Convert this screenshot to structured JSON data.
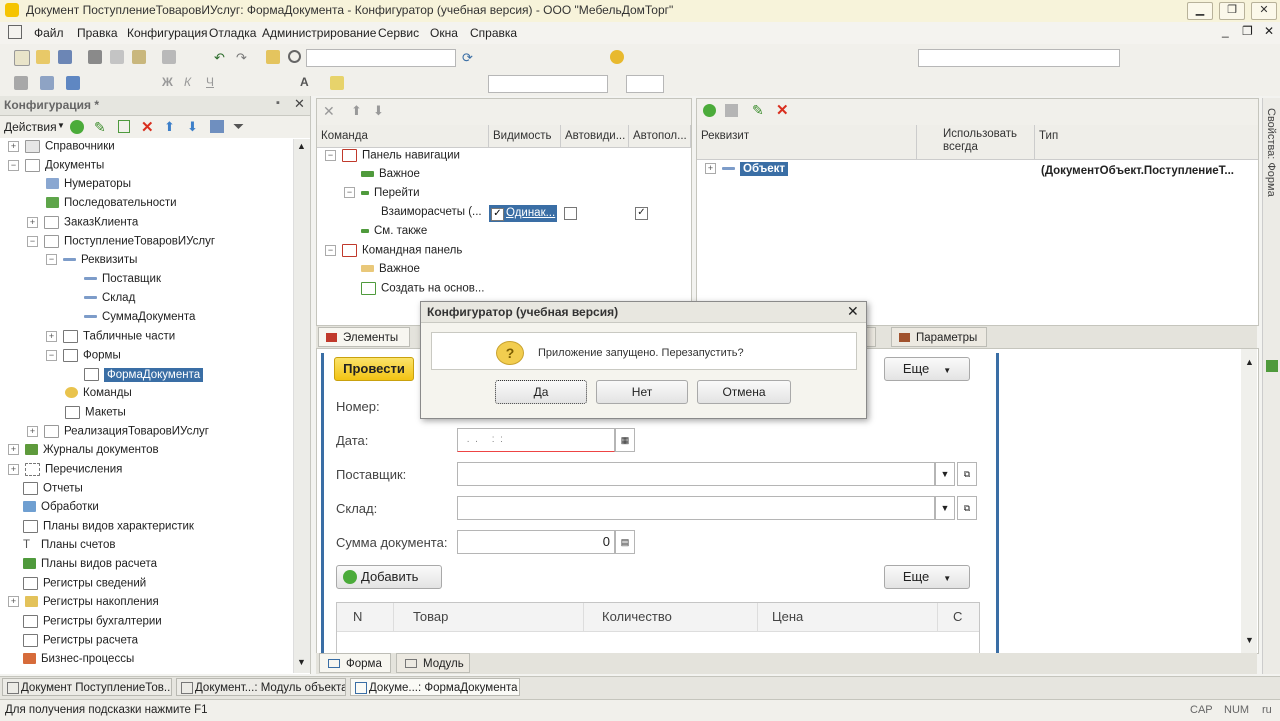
{
  "window": {
    "title": "Документ ПоступлениеТоваровИУслуг: ФормаДокумента - Конфигуратор (учебная версия) - ООО \"МебельДомТорг\""
  },
  "menu": [
    "Файл",
    "Правка",
    "Конфигурация",
    "Отладка",
    "Администрирование",
    "Сервис",
    "Окна",
    "Справка"
  ],
  "config_panel": {
    "title": "Конфигурация *",
    "actions_label": "Действия",
    "tree": [
      {
        "label": "Справочники"
      },
      {
        "label": "Документы"
      },
      {
        "label": "Нумераторы"
      },
      {
        "label": "Последовательности"
      },
      {
        "label": "ЗаказКлиента"
      },
      {
        "label": "ПоступлениеТоваровИУслуг"
      },
      {
        "label": "Реквизиты"
      },
      {
        "label": "Поставщик"
      },
      {
        "label": "Склад"
      },
      {
        "label": "СуммаДокумента"
      },
      {
        "label": "Табличные части"
      },
      {
        "label": "Формы"
      },
      {
        "label": "ФормаДокумента"
      },
      {
        "label": "Команды"
      },
      {
        "label": "Макеты"
      },
      {
        "label": "РеализацияТоваровИУслуг"
      },
      {
        "label": "Журналы документов"
      },
      {
        "label": "Перечисления"
      },
      {
        "label": "Отчеты"
      },
      {
        "label": "Обработки"
      },
      {
        "label": "Планы видов характеристик"
      },
      {
        "label": "Планы счетов"
      },
      {
        "label": "Планы видов расчета"
      },
      {
        "label": "Регистры сведений"
      },
      {
        "label": "Регистры накопления"
      },
      {
        "label": "Регистры бухгалтерии"
      },
      {
        "label": "Регистры расчета"
      },
      {
        "label": "Бизнес-процессы"
      }
    ]
  },
  "commands_panel": {
    "headers": [
      "Команда",
      "Видимость",
      "Автовиди...",
      "Автопол..."
    ],
    "rows": [
      {
        "label": "Панель навигации"
      },
      {
        "label": "Важное"
      },
      {
        "label": "Перейти"
      },
      {
        "label": "Взаиморасчеты (...",
        "visibility": "Одинак..."
      },
      {
        "label": "См. также"
      },
      {
        "label": "Командная панель"
      },
      {
        "label": "Важное"
      },
      {
        "label": "Создать на основ..."
      }
    ]
  },
  "attributes_panel": {
    "headers": [
      "Реквизит",
      "Использовать всегда",
      "Тип"
    ],
    "row": {
      "name": "Объект",
      "type": "(ДокументОбъект.ПоступлениеТ..."
    }
  },
  "mid_tabs": [
    "Элементы",
    "Кома",
    "ы",
    "Параметры"
  ],
  "form_preview": {
    "post_button": "Провести",
    "more_label": "Еще",
    "labels": {
      "number": "Номер:",
      "date": "Дата:",
      "supplier": "Поставщик:",
      "warehouse": "Склад:",
      "sum": "Сумма документа:"
    },
    "date_value": " .  .     :  :",
    "sum_value": "0",
    "add_button": "Добавить",
    "table_headers": [
      "N",
      "Товар",
      "Количество",
      "Цена",
      "С"
    ]
  },
  "bottom_tabs": [
    "Форма",
    "Модуль"
  ],
  "dialog": {
    "title": "Конфигуратор (учебная версия)",
    "message": "Приложение запущено. Перезапустить?",
    "yes": "Да",
    "no": "Нет",
    "cancel": "Отмена"
  },
  "taskbar": [
    "Документ ПоступлениеТов...",
    "Документ...: Модуль объекта",
    "Докуме...: ФормаДокумента"
  ],
  "status": {
    "hint": "Для получения подсказки нажмите F1",
    "cap": "CAP",
    "num": "NUM",
    "lang": "ru"
  },
  "right_sidebar_label": "Свойства: Форма"
}
